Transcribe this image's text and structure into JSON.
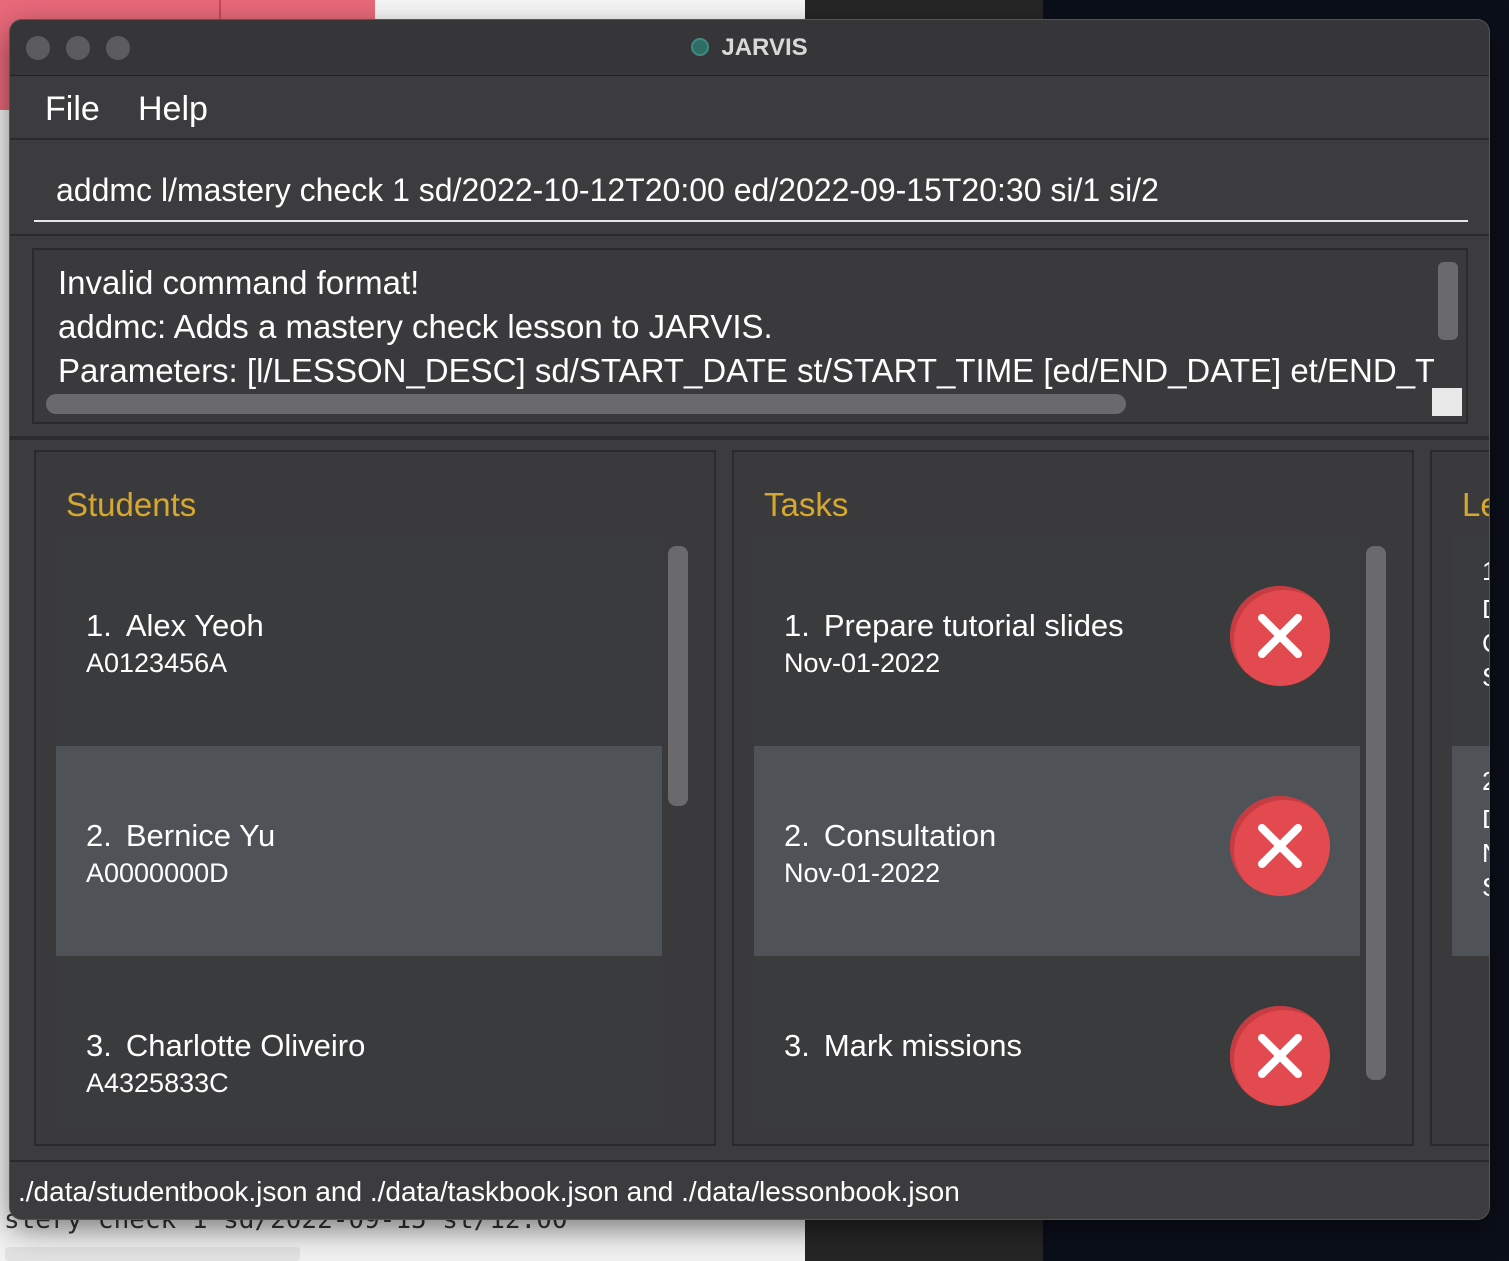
{
  "background": {
    "code_fragment": "stery check 1 sd/2022-09-15 st/12:00"
  },
  "window": {
    "title": "JARVIS",
    "icon": "jarvis-app-icon"
  },
  "menu": {
    "file_label": "File",
    "help_label": "Help"
  },
  "command": {
    "value": "addmc l/mastery check 1 sd/2022-10-12T20:00 ed/2022-09-15T20:30 si/1 si/2"
  },
  "result": {
    "lines": [
      "Invalid command format!",
      "addmc: Adds a mastery check lesson to JARVIS.",
      "Parameters: [l/LESSON_DESC] sd/START_DATE st/START_TIME [ed/END_DATE] et/END_TIME"
    ]
  },
  "students": {
    "title": "Students",
    "items": [
      {
        "index": "1.",
        "name": "Alex Yeoh",
        "matric": "A0123456A"
      },
      {
        "index": "2.",
        "name": "Bernice Yu",
        "matric": "A0000000D"
      },
      {
        "index": "3.",
        "name": "Charlotte Oliveiro",
        "matric": "A4325833C"
      }
    ]
  },
  "tasks": {
    "title": "Tasks",
    "items": [
      {
        "index": "1.",
        "desc": "Prepare tutorial slides",
        "deadline": "Nov-01-2022"
      },
      {
        "index": "2.",
        "desc": "Consultation",
        "deadline": "Nov-01-2022"
      },
      {
        "index": "3.",
        "desc": "Mark missions",
        "deadline": ""
      }
    ],
    "delete_icon": "close-x-icon"
  },
  "lessons": {
    "title": "Le",
    "fragments": [
      [
        "1",
        "D",
        "C",
        "S"
      ],
      [
        "2",
        "D",
        "N",
        "S"
      ]
    ]
  },
  "status": {
    "text": "./data/studentbook.json and ./data/taskbook.json and ./data/lessonbook.json"
  },
  "colors": {
    "accent_title": "#d6a92e",
    "delete_red": "#e24a4f",
    "window_bg": "#3c3c3e"
  }
}
